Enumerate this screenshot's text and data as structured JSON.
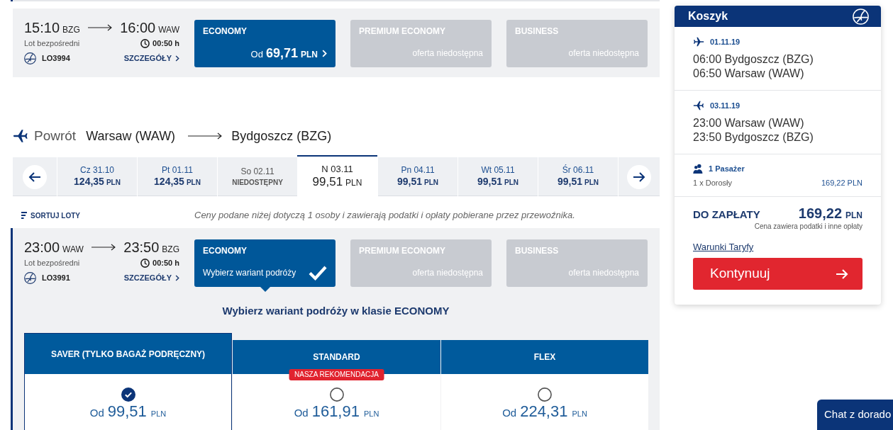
{
  "outbound_flight": {
    "departure": {
      "time": "15:10",
      "code": "BZG"
    },
    "arrival": {
      "time": "16:00",
      "code": "WAW"
    },
    "flight_type": "Lot bezpośredni",
    "duration": "00:50 h",
    "flight_number": "LO3994",
    "details_link": "SZCZEGÓŁY",
    "fares": [
      {
        "name": "ECONOMY",
        "kind": "available",
        "selected": false,
        "prefix": "Od",
        "price": "69,71",
        "currency": "PLN"
      },
      {
        "name": "PREMIUM ECONOMY",
        "kind": "unavailable",
        "selected": false,
        "note": "oferta niedostępna"
      },
      {
        "name": "BUSINESS",
        "kind": "unavailable",
        "selected": false,
        "note": "oferta niedostępna"
      }
    ]
  },
  "return_header": {
    "label": "Powrót",
    "from": "Warsaw (WAW)",
    "to": "Bydgoszcz (BZG)"
  },
  "date_tabs": [
    {
      "day": "Cz 31.10",
      "price": "124,35",
      "currency": "PLN",
      "selected": false
    },
    {
      "day": "Pt 01.11",
      "price": "124,35",
      "currency": "PLN",
      "selected": false
    },
    {
      "day": "So 02.11",
      "status": "NIEDOSTĘPNY",
      "selected": false
    },
    {
      "day": "N 03.11",
      "price": "99,51",
      "currency": "PLN",
      "selected": true
    },
    {
      "day": "Pn 04.11",
      "price": "99,51",
      "currency": "PLN",
      "selected": false
    },
    {
      "day": "Wt 05.11",
      "price": "99,51",
      "currency": "PLN",
      "selected": false
    },
    {
      "day": "Śr 06.11",
      "price": "99,51",
      "currency": "PLN",
      "selected": false
    }
  ],
  "sort_button": "SORTUJ LOTY",
  "price_note": "Ceny podane niżej dotyczą 1 osoby i zawierają podatki i opłaty pobierane przez przewoźnika.",
  "return_flight": {
    "departure": {
      "time": "23:00",
      "code": "WAW"
    },
    "arrival": {
      "time": "23:50",
      "code": "BZG"
    },
    "flight_type": "Lot bezpośredni",
    "duration": "00:50 h",
    "flight_number": "LO3991",
    "details_link": "SZCZEGÓŁY",
    "fares": [
      {
        "name": "ECONOMY",
        "kind": "available",
        "selected": true,
        "note": "Wybierz wariant podróży"
      },
      {
        "name": "PREMIUM ECONOMY",
        "kind": "unavailable",
        "selected": false,
        "note": "oferta niedostępna"
      },
      {
        "name": "BUSINESS",
        "kind": "unavailable",
        "selected": false,
        "note": "oferta niedostępna"
      }
    ],
    "variants_title": "Wybierz wariant podróży w klasie ECONOMY",
    "variants": [
      {
        "name": "SAVER (TYLKO BAGAŻ PODRĘCZNY)",
        "selected": true,
        "prefix": "Od",
        "price": "99,51",
        "currency": "PLN"
      },
      {
        "name": "STANDARD",
        "selected": false,
        "badge": "NASZA REKOMENDACJA",
        "prefix": "Od",
        "price": "161,91",
        "currency": "PLN"
      },
      {
        "name": "FLEX",
        "selected": false,
        "prefix": "Od",
        "price": "224,31",
        "currency": "PLN"
      }
    ]
  },
  "cart": {
    "title": "Koszyk",
    "legs": [
      {
        "kind": "outbound",
        "date": "01.11.19",
        "lines": [
          "06:00 Bydgoszcz (BZG)",
          "06:50 Warsaw (WAW)"
        ]
      },
      {
        "kind": "return",
        "date": "03.11.19",
        "lines": [
          "23:00 Warsaw (WAW)",
          "23:50 Bydgoszcz (BZG)"
        ]
      }
    ],
    "passengers": {
      "label": "1 Pasażer",
      "type": "1 x Dorosły",
      "price": "169,22 PLN"
    },
    "total": {
      "label": "DO ZAPŁATY",
      "amount": "169,22",
      "currency": "PLN",
      "note": "Cena zawiera podatki i inne opłaty"
    },
    "fare_rules_link": "Warunki Taryfy",
    "continue_button": "Kontynuuj"
  },
  "chat_button": "Chat z dorado"
}
